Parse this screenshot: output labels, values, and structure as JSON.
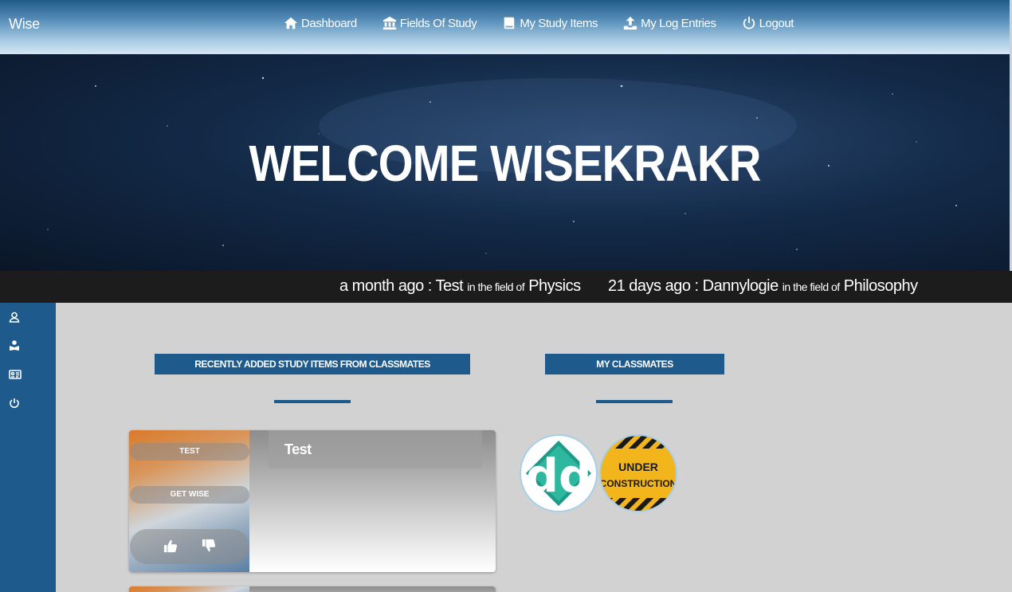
{
  "brand": "Wise",
  "nav": [
    {
      "label": "Dashboard",
      "icon": "home-icon"
    },
    {
      "label": "Fields Of Study",
      "icon": "bank-icon"
    },
    {
      "label": "My Study Items",
      "icon": "book-icon"
    },
    {
      "label": "My Log Entries",
      "icon": "upload-icon"
    },
    {
      "label": "Logout",
      "icon": "power-icon"
    }
  ],
  "hero": {
    "title": "WELCOME WISEKRAKR"
  },
  "ticker": [
    {
      "time": "a month ago : Test",
      "mid": "in the field of",
      "field": "Physics"
    },
    {
      "time": "21 days ago : Dannylogie",
      "mid": "in the field of",
      "field": "Philosophy"
    }
  ],
  "sidebar": [
    {
      "icon": "user-icon"
    },
    {
      "icon": "reader-icon"
    },
    {
      "icon": "id-card-icon"
    },
    {
      "icon": "power-icon"
    }
  ],
  "sections": {
    "recent_title": "RECENTLY ADDED STUDY ITEMS FROM CLASSMATES",
    "classmates_title": "MY CLASSMATES"
  },
  "study_items": [
    {
      "tag": "TEST",
      "action": "GET WISE",
      "title": "Test"
    }
  ],
  "classmates": [
    {
      "name": "dd",
      "avatar_text": "dd"
    },
    {
      "name": "under-construction",
      "avatar_text": "UNDER CONSTRUCTION"
    }
  ],
  "colors": {
    "accent": "#1e5b8c",
    "ticker_bg": "#1c1c1c",
    "content_bg": "#d3d2d3"
  }
}
